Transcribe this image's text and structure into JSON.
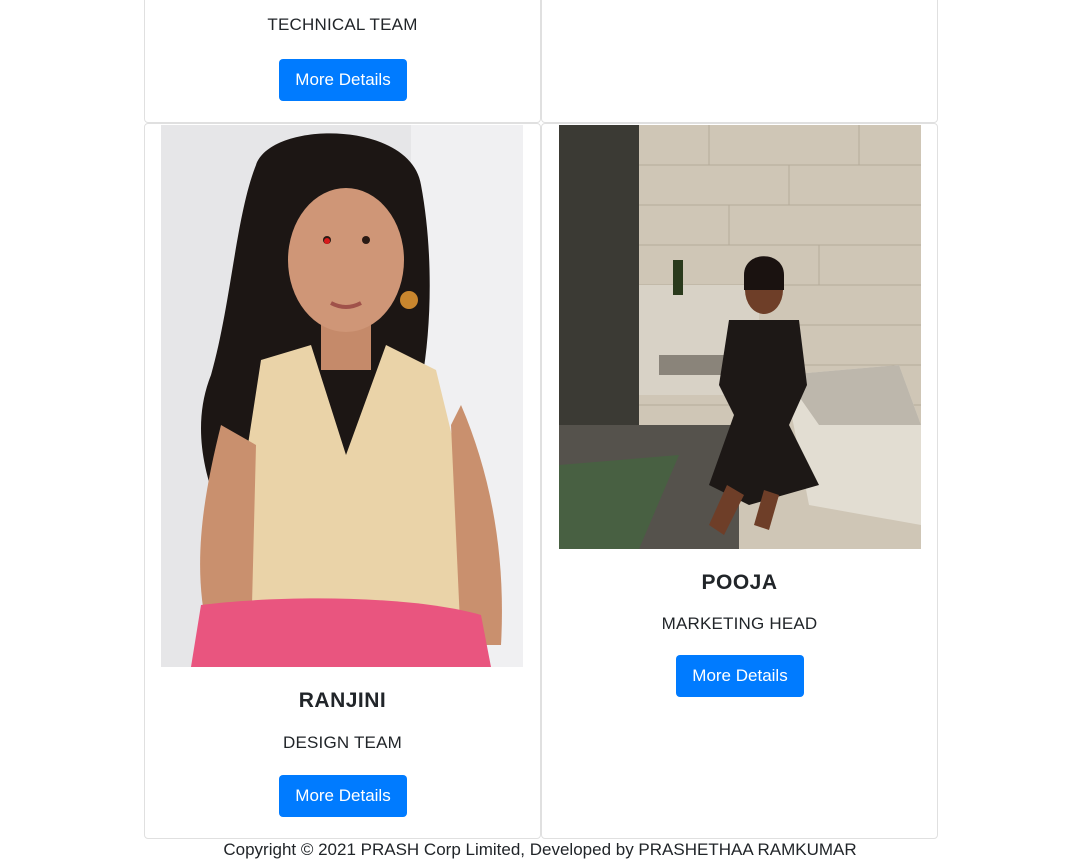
{
  "cards": {
    "top_left": {
      "role": "TECHNICAL TEAM",
      "button_label": "More Details"
    },
    "bottom_left": {
      "name": "RANJINI",
      "role": "DESIGN TEAM",
      "button_label": "More Details"
    },
    "bottom_right": {
      "name": "POOJA",
      "role": "MARKETING HEAD",
      "button_label": "More Details"
    }
  },
  "footer": {
    "copyright": "Copyright © 2021 PRASH Corp Limited, Developed by PRASHETHAA RAMKUMAR"
  },
  "colors": {
    "button_bg": "#007bff",
    "button_text": "#ffffff",
    "text": "#212529",
    "card_border": "#e0e0e0"
  }
}
